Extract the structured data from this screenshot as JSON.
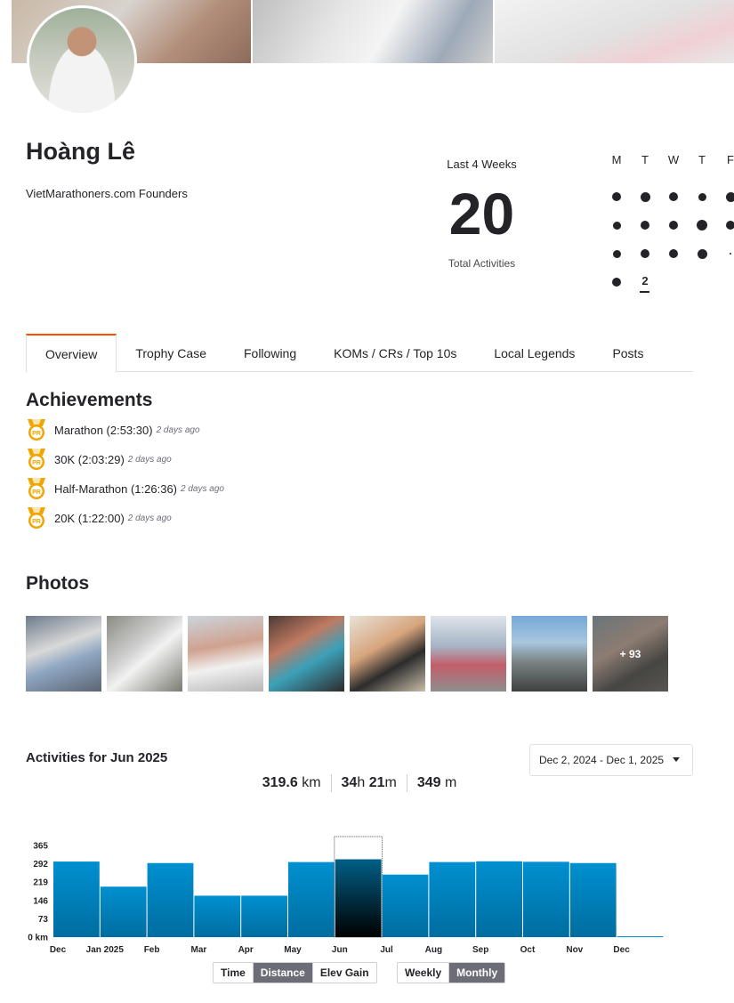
{
  "profile": {
    "name": "Hoàng Lê",
    "bio": "VietMarathoners.com Founders"
  },
  "summary": {
    "period_label": "Last 4 Weeks",
    "total_activities": "20",
    "total_label": "Total Activities"
  },
  "calendar": {
    "days": [
      "M",
      "T",
      "W",
      "T",
      "F"
    ],
    "today_count": "2"
  },
  "tabs": [
    {
      "label": "Overview",
      "active": true
    },
    {
      "label": "Trophy Case"
    },
    {
      "label": "Following"
    },
    {
      "label": "KOMs / CRs / Top 10s"
    },
    {
      "label": "Local Legends"
    },
    {
      "label": "Posts"
    }
  ],
  "achievements": {
    "title": "Achievements",
    "items": [
      {
        "text": "Marathon (2:53:30)",
        "ago": "2 days ago",
        "badge": "PR"
      },
      {
        "text": "30K (2:03:29)",
        "ago": "2 days ago",
        "badge": "PR"
      },
      {
        "text": "Half-Marathon (1:26:36)",
        "ago": "2 days ago",
        "badge": "PR"
      },
      {
        "text": "20K (1:22:00)",
        "ago": "2 days ago",
        "badge": "PR"
      }
    ]
  },
  "photos": {
    "title": "Photos",
    "more_label": "+ 93"
  },
  "activities": {
    "title": "Activities for Jun 2025",
    "date_range": "Dec 2, 2024 - Dec 1, 2025",
    "distance_value": "319.6",
    "distance_unit": "km",
    "time_hours": "34",
    "time_h_unit": "h",
    "time_minutes": "21",
    "time_m_unit": "m",
    "elev_value": "349",
    "elev_unit": "m",
    "metric_toggle": [
      "Time",
      "Distance",
      "Elev Gain"
    ],
    "metric_selected": "Distance",
    "period_toggle": [
      "Weekly",
      "Monthly"
    ],
    "period_selected": "Monthly"
  },
  "colors": {
    "accent": "#fc5200",
    "bar_top": "#0090d0",
    "bar_bottom": "#006da0",
    "bar_selected_top": "#005f86",
    "bar_selected_bottom": "#000000",
    "medal": "#f0a500"
  },
  "chart_data": {
    "type": "bar",
    "categories": [
      "Dec",
      "Jan 2025",
      "Feb",
      "Mar",
      "Apr",
      "May",
      "Jun",
      "Jul",
      "Aug",
      "Sep",
      "Oct",
      "Nov",
      "Dec"
    ],
    "values": [
      301,
      201,
      295,
      165,
      165,
      299,
      310,
      249,
      299,
      302,
      300,
      295,
      0
    ],
    "selected": "Jun",
    "yticks": [
      "0 km",
      "73",
      "146",
      "219",
      "292",
      "365"
    ],
    "ylim": [
      0,
      365
    ],
    "xlabel": "",
    "ylabel": ""
  }
}
